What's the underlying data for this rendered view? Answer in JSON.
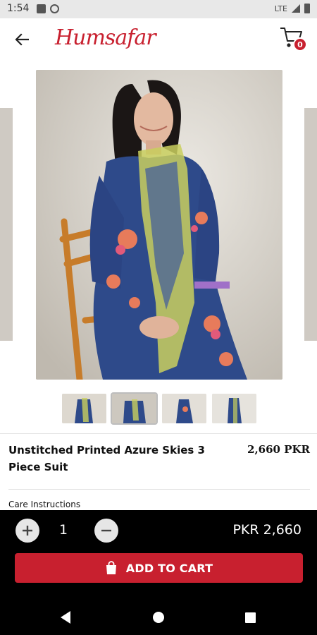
{
  "status_bar": {
    "time": "1:54",
    "network": "LTE"
  },
  "app_bar": {
    "logo_text": "Humsafar",
    "cart_count": "0"
  },
  "product": {
    "title": "Unstitched Printed Azure Skies 3 Piece Suit",
    "price": "2,660 PKR",
    "care_label": "Care Instructions",
    "gallery_count": 4,
    "active_thumbnail": 2
  },
  "purchase": {
    "quantity": "1",
    "total": "PKR 2,660",
    "add_to_cart_label": "ADD TO CART"
  },
  "colors": {
    "brand": "#c8202f",
    "outfit": "#2e4a8a",
    "background_image": "#cbc6bd"
  },
  "icons": {
    "back": "arrow-left-icon",
    "cart": "shopping-cart-icon",
    "bag": "shopping-bag-icon",
    "plus": "plus-icon",
    "minus": "minus-icon"
  }
}
